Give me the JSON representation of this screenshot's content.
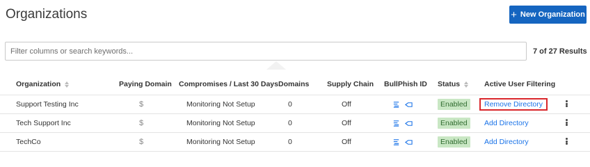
{
  "page": {
    "title": "Organizations",
    "new_button_label": "New Organization"
  },
  "filter": {
    "placeholder": "Filter columns or search keywords...",
    "value": ""
  },
  "results": {
    "count_label": "7 of 27 Results"
  },
  "table": {
    "headers": {
      "organization": "Organization",
      "paying_domain": "Paying Domain",
      "compromises": "Compromises / Last 30 Days",
      "domains": "Domains",
      "supply_chain": "Supply Chain",
      "bullphish_id": "BullPhish ID",
      "status": "Status",
      "active_user_filtering": "Active User Filtering"
    },
    "rows": [
      {
        "organization": "Support Testing Inc",
        "paying_domain": "$",
        "compromises": "Monitoring Not Setup",
        "domains": "0",
        "supply_chain": "Off",
        "status": "Enabled",
        "active_user_filtering": "Remove Directory"
      },
      {
        "organization": "Tech Support Inc",
        "paying_domain": "$",
        "compromises": "Monitoring Not Setup",
        "domains": "0",
        "supply_chain": "Off",
        "status": "Enabled",
        "active_user_filtering": "Add Directory"
      },
      {
        "organization": "TechCo",
        "paying_domain": "$",
        "compromises": "Monitoring Not Setup",
        "domains": "0",
        "supply_chain": "Off",
        "status": "Enabled",
        "active_user_filtering": "Add Directory"
      }
    ]
  },
  "colors": {
    "primary": "#1565c0",
    "link": "#1a73e8",
    "status_bg": "#c9e7c4",
    "highlight": "#d9262b"
  },
  "icons": {
    "new": "plus-icon",
    "sort": "sort-icon",
    "bullphish": [
      "bullphish-campaign-icon",
      "bullphish-hook-icon"
    ],
    "row_menu": "kebab-menu-icon"
  }
}
